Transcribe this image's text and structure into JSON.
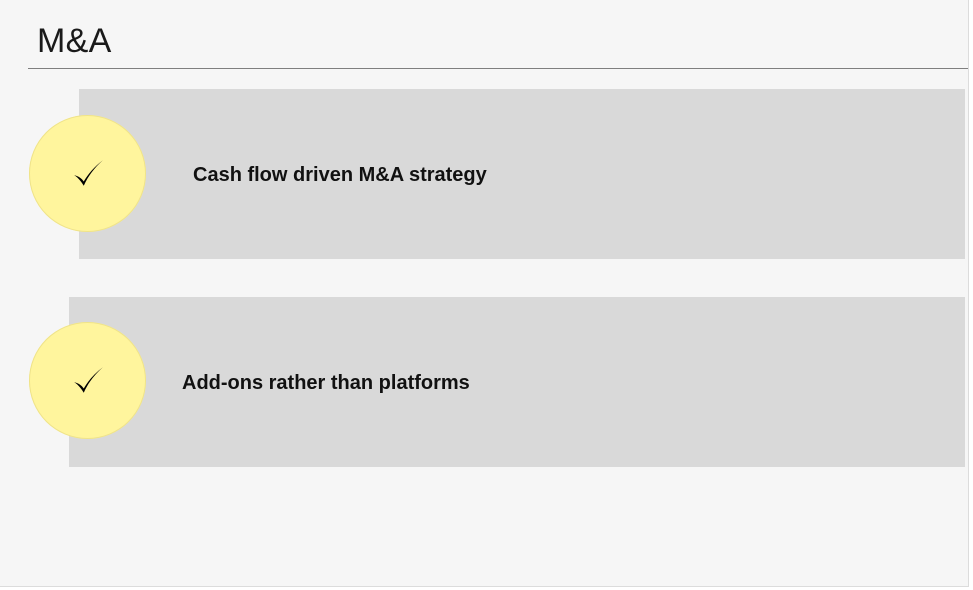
{
  "slide": {
    "title": "M&A",
    "items": [
      {
        "label": "Cash flow driven M&A strategy",
        "icon": "checkmark-icon"
      },
      {
        "label": "Add-ons rather than platforms",
        "icon": "checkmark-icon"
      }
    ]
  },
  "colors": {
    "slide_background": "#f6f6f6",
    "panel_background": "#d9d9d9",
    "check_circle": "#fff59d",
    "text": "#111111"
  }
}
